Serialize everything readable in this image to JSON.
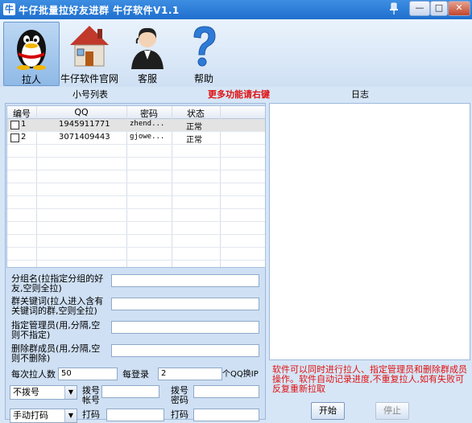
{
  "window": {
    "app_icon": "牛",
    "title": "牛仔批量拉好友进群  牛仔软件V1.1",
    "icons": {
      "pin": "pin-icon",
      "minimize": "minimize-icon",
      "maximize": "maximize-icon",
      "close": "close-icon"
    },
    "controls": {
      "minimize": "—",
      "maximize": "□",
      "close": "✕"
    }
  },
  "toolbar": {
    "items": [
      {
        "label": "拉人",
        "icon": "qq-penguin-icon",
        "selected": true
      },
      {
        "label": "牛仔软件官网",
        "icon": "house-icon",
        "selected": false
      },
      {
        "label": "客服",
        "icon": "customer-service-icon",
        "selected": false
      },
      {
        "label": "帮助",
        "icon": "question-mark-icon",
        "selected": false
      }
    ]
  },
  "sections": {
    "account_list": "小号列表",
    "more_features": "更多功能请右键",
    "log": "日志"
  },
  "table": {
    "columns": [
      "编号",
      "QQ",
      "密码",
      "状态"
    ],
    "rows": [
      {
        "id": "1",
        "qq": "1945911771",
        "password": "zhend...",
        "status": "正常"
      },
      {
        "id": "2",
        "qq": "3071409443",
        "password": "gjowe...",
        "status": "正常"
      }
    ]
  },
  "form": {
    "group_name_label": "分组名(拉指定分组的好友,空则全拉)",
    "group_name_value": "",
    "keyword_label": "群关键词(拉人进入含有关键词的群,空则全拉)",
    "keyword_value": "",
    "admin_label": "指定管理员(用,分隔,空则不指定)",
    "admin_value": "",
    "remove_label": "删除群成员(用,分隔,空则不删除)",
    "remove_value": "",
    "per_pull_label": "每次拉人数",
    "per_pull_value": "50",
    "per_login_label": "每登录",
    "per_login_value": "2",
    "per_login_suffix": "个QQ换IP",
    "dial_select": "不拨号",
    "dial_account_label": "拨号帐号",
    "dial_account_value": "",
    "dial_password_label": "拨号密码",
    "dial_password_value": "",
    "captcha_select": "手动打码",
    "captcha_label1": "打码",
    "captcha_label2": "打码"
  },
  "log": {
    "note": "软件可以同时进行拉人、指定管理员和删除群成员操作。软件自动记录进度,不重复拉人,如有失败可反复重新拉取"
  },
  "buttons": {
    "start": "开始",
    "stop": "停止"
  },
  "colors": {
    "titlebar": "#1f6fce",
    "accent_red": "#e01010",
    "panel_bg": "#d6e6f7"
  }
}
